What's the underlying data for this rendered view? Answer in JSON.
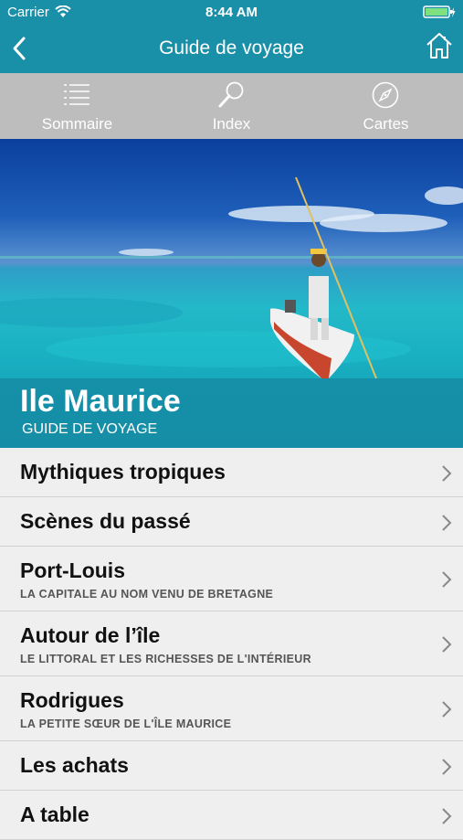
{
  "status_bar": {
    "carrier": "Carrier",
    "time": "8:44 AM"
  },
  "nav": {
    "title": "Guide de voyage"
  },
  "toolbar": {
    "items": [
      {
        "label": "Sommaire",
        "icon": "list-icon"
      },
      {
        "label": "Index",
        "icon": "magnifier-icon"
      },
      {
        "label": "Cartes",
        "icon": "compass-icon"
      }
    ]
  },
  "hero": {
    "title": "Ile Maurice",
    "subtitle": "GUIDE DE VOYAGE"
  },
  "sections": [
    {
      "title": "Mythiques tropiques",
      "subtitle": ""
    },
    {
      "title": "Scènes du passé",
      "subtitle": ""
    },
    {
      "title": "Port-Louis",
      "subtitle": "LA CAPITALE AU NOM VENU DE BRETAGNE"
    },
    {
      "title": "Autour de l’île",
      "subtitle": "LE LITTORAL ET LES RICHESSES DE L'INTÉRIEUR"
    },
    {
      "title": "Rodrigues",
      "subtitle": "LA PETITE SŒUR DE L'ÎLE MAURICE"
    },
    {
      "title": "Les achats",
      "subtitle": ""
    },
    {
      "title": "A table",
      "subtitle": ""
    }
  ],
  "colors": {
    "accent": "#1a8fa8",
    "toolbar": "#bdbdbd",
    "list_bg": "#efefef"
  }
}
